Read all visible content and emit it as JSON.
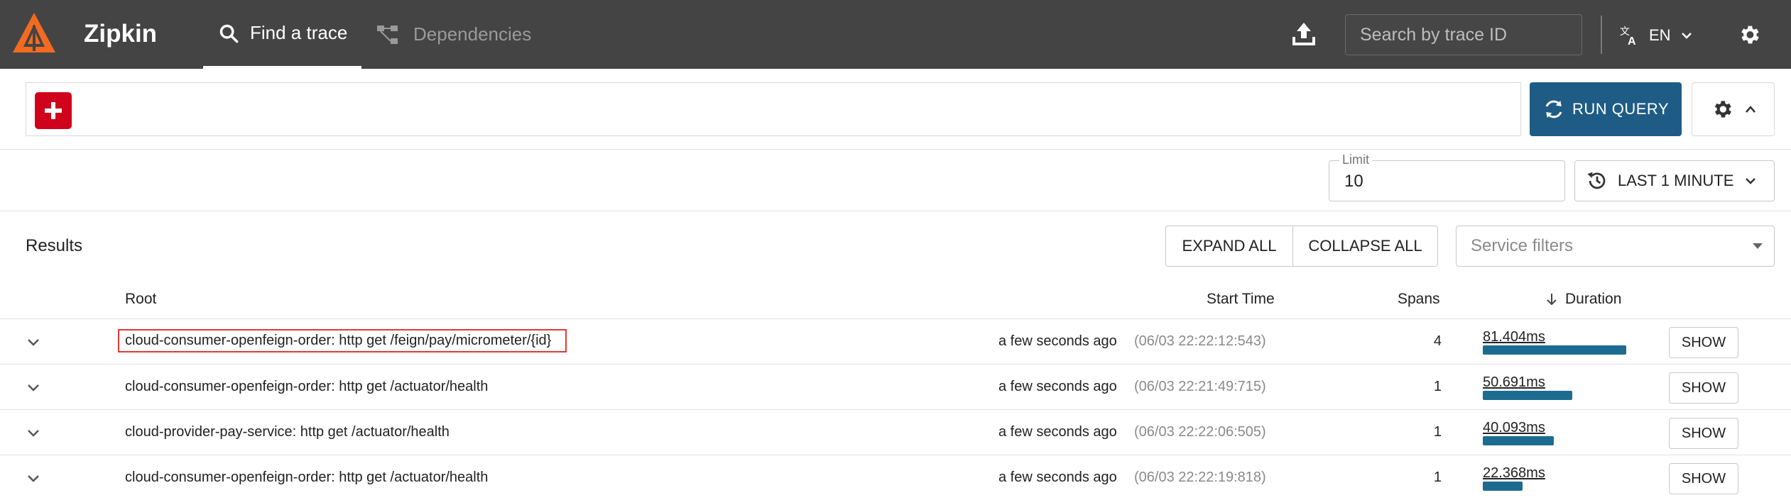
{
  "app": {
    "title": "Zipkin"
  },
  "nav": {
    "find_trace": "Find a trace",
    "dependencies": "Dependencies"
  },
  "search": {
    "placeholder": "Search by trace ID"
  },
  "language": {
    "label": "EN"
  },
  "query": {
    "run_label": "RUN QUERY"
  },
  "limit": {
    "label": "Limit",
    "value": "10"
  },
  "lookback": {
    "label": "LAST 1 MINUTE"
  },
  "results": {
    "title": "Results",
    "expand_all": "EXPAND ALL",
    "collapse_all": "COLLAPSE ALL",
    "service_filters_placeholder": "Service filters",
    "columns": {
      "root": "Root",
      "start_time": "Start Time",
      "spans": "Spans",
      "duration": "Duration"
    },
    "rows": [
      {
        "root": "cloud-consumer-openfeign-order: http get /feign/pay/micrometer/{id}",
        "start_relative": "a few seconds ago",
        "start_absolute": "(06/03 22:22:12:543)",
        "spans": "4",
        "duration": "81.404ms",
        "duration_fraction": 1.0,
        "show": "SHOW",
        "highlighted": true
      },
      {
        "root": "cloud-consumer-openfeign-order: http get /actuator/health",
        "start_relative": "a few seconds ago",
        "start_absolute": "(06/03 22:21:49:715)",
        "spans": "1",
        "duration": "50.691ms",
        "duration_fraction": 0.623,
        "show": "SHOW",
        "highlighted": false
      },
      {
        "root": "cloud-provider-pay-service: http get /actuator/health",
        "start_relative": "a few seconds ago",
        "start_absolute": "(06/03 22:22:06:505)",
        "spans": "1",
        "duration": "40.093ms",
        "duration_fraction": 0.493,
        "show": "SHOW",
        "highlighted": false
      },
      {
        "root": "cloud-consumer-openfeign-order: http get /actuator/health",
        "start_relative": "a few seconds ago",
        "start_absolute": "(06/03 22:22:19:818)",
        "spans": "1",
        "duration": "22.368ms",
        "duration_fraction": 0.275,
        "show": "SHOW",
        "highlighted": false
      }
    ]
  },
  "colors": {
    "topbar": "#444444",
    "logo": "#f26b21",
    "add_button": "#d0021b",
    "primary": "#1e5c86",
    "duration_bar": "#1e6b91",
    "highlight": "#e53935"
  }
}
